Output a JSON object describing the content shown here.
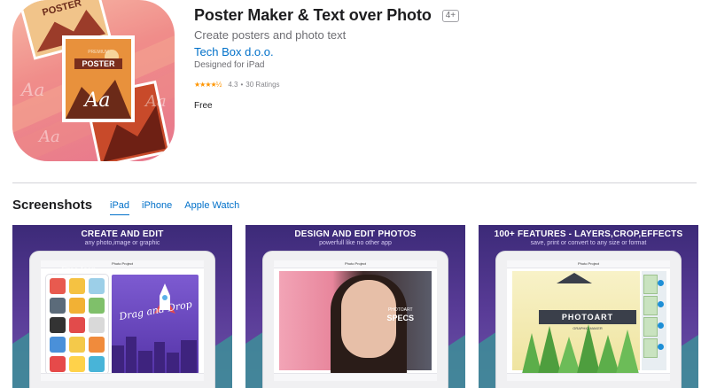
{
  "app": {
    "title": "Poster Maker & Text over Photo",
    "age_rating": "4+",
    "subtitle": "Create posters and photo text",
    "developer": "Tech Box d.o.o.",
    "designed_for": "Designed for iPad",
    "stars": "★★★★½",
    "rating": "4.3",
    "ratings_count": "30 Ratings",
    "price": "Free"
  },
  "icon_art": {
    "poster_label": "POSTER",
    "premium_label": "PREMIUM",
    "back_label": "POSTER",
    "script_text": "Aa"
  },
  "screenshots": {
    "heading": "Screenshots",
    "tabs": [
      {
        "label": "iPad",
        "active": true
      },
      {
        "label": "iPhone",
        "active": false
      },
      {
        "label": "Apple Watch",
        "active": false
      }
    ],
    "items": [
      {
        "title": "CREATE AND EDIT",
        "subtitle": "any photo,image or graphic",
        "screen_title": "Photo Project",
        "free_icon": "Free Icon",
        "drag_drop": "Drag and Drop"
      },
      {
        "title": "DESIGN AND EDIT PHOTOS",
        "subtitle": "powerfull like no other app",
        "screen_title": "Photo Project",
        "overlay_top": "PHOTOART",
        "overlay_main": "SPECS"
      },
      {
        "title": "100+ FEATURES - LAYERS,CROP,EFFECTS",
        "subtitle": "save, print or convert to any size or format",
        "screen_title": "Photo Project",
        "badge_title": "PHOTOART",
        "badge_sub": "GRAPHIC MAKER"
      }
    ]
  },
  "colors": {
    "link": "#0070c9",
    "star": "#ff9500",
    "shot_bg": "#4a3288"
  }
}
